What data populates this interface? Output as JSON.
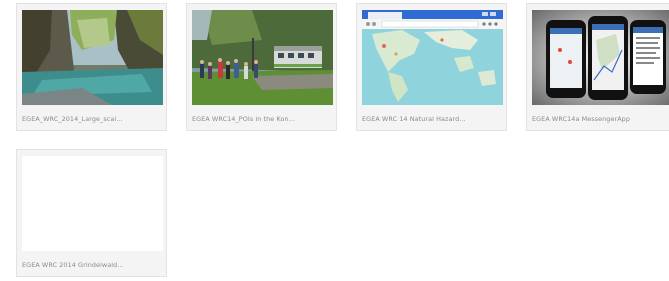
{
  "gallery": {
    "items": [
      {
        "caption": "EGEA_WRC_2014_Large_scal…",
        "thumb": "river-canyon-photo"
      },
      {
        "caption": "EGEA WRC14_POIs in the Kon…",
        "thumb": "train-hikers-photo"
      },
      {
        "caption": "EGEA WRC 14 Natural Hazard…",
        "thumb": "browser-map-screenshot"
      },
      {
        "caption": "EGEA WRC14a MessengerApp",
        "thumb": "phone-apps-screenshot"
      },
      {
        "caption": "EGEA WRC 2014 Grindelwald…",
        "thumb": "blank-thumbnail"
      }
    ]
  }
}
